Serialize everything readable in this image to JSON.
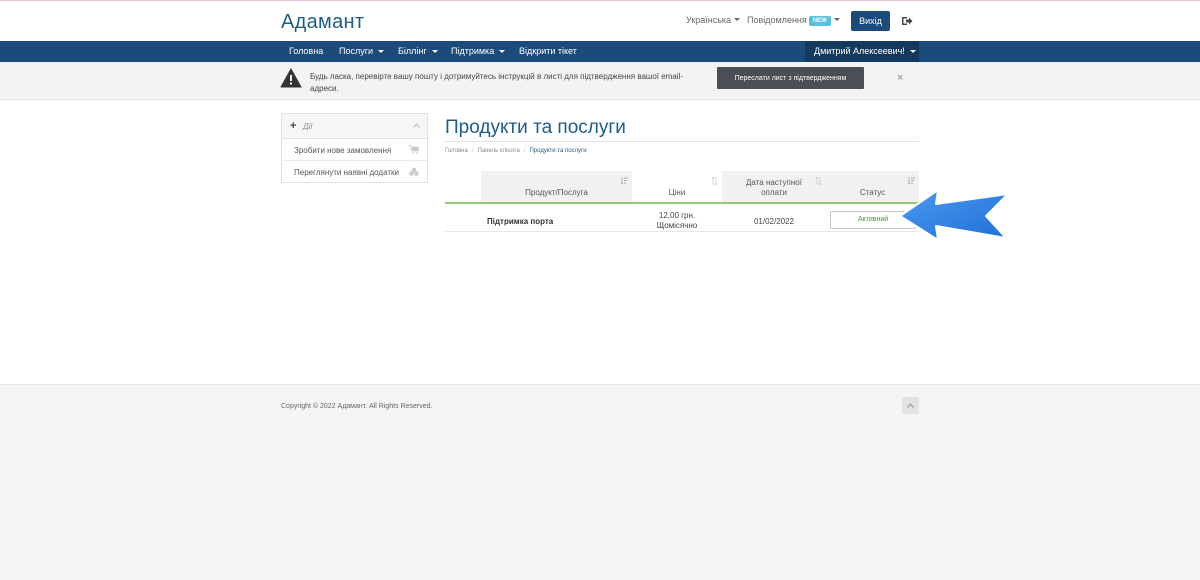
{
  "header": {
    "logo": "Адамант",
    "language": "Українська",
    "notifications": "Повідомлення",
    "new_badge": "NEW",
    "logout": "Вихід"
  },
  "nav": {
    "items": [
      {
        "label": "Головна"
      },
      {
        "label": "Послуги"
      },
      {
        "label": "Біллінг"
      },
      {
        "label": "Підтримка"
      },
      {
        "label": "Відкрити тікет"
      }
    ],
    "user": "Дмитрий Алексеевич!"
  },
  "alert": {
    "text": "Будь ласка, перевірте вашу пошту і дотримуйтесь інструкцій в листі для підтвердження вашої email-адреси.",
    "button": "Переслати лист з підтвердженням",
    "close": "×"
  },
  "sidebar": {
    "title": "Дії",
    "items": [
      {
        "label": "Зробити нове замовлення",
        "icon": "cart-icon"
      },
      {
        "label": "Переглянути наявні додатки",
        "icon": "cubes-icon"
      }
    ]
  },
  "page": {
    "title": "Продукти та послуги",
    "breadcrumb": [
      "Головна",
      "Панель клієнта",
      "Продукти та послуги"
    ]
  },
  "table": {
    "headers": [
      "Продукт/Послуга",
      "Ціни",
      "Дата наступної оплати",
      "Статус"
    ],
    "rows": [
      {
        "product": "Підтримка порта",
        "price": "12,00 грн.",
        "cycle": "Щомісячно",
        "next_due": "01/02/2022",
        "status": "Активний"
      }
    ]
  },
  "footer": {
    "copyright": "Copyright © 2022 Адамант. All Rights Reserved."
  },
  "colors": {
    "brand": "#1a4b7a",
    "nav_user": "#12395e",
    "accent_line": "#8fcc73",
    "status_active": "#3a9a3a",
    "arrow": "#2f7fe0"
  }
}
